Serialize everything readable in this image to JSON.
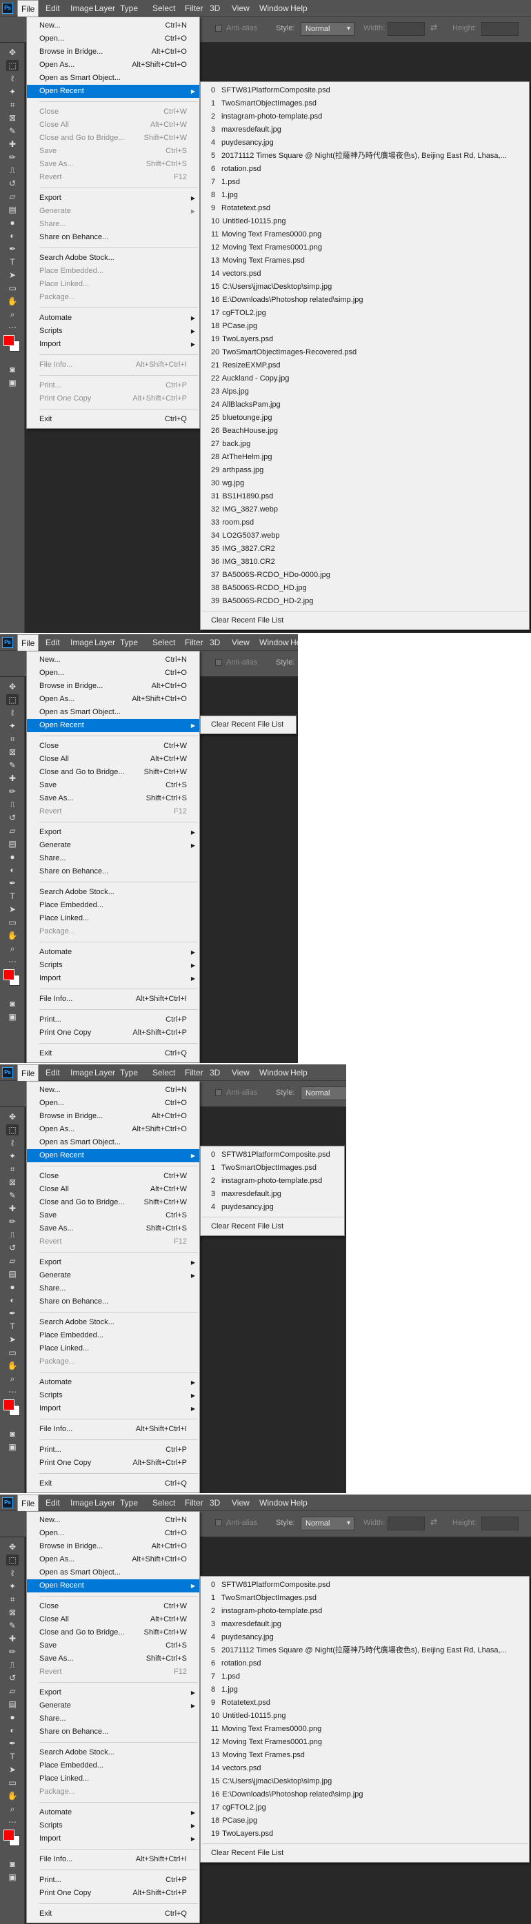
{
  "app": {
    "logo": "Ps"
  },
  "menubar": [
    "File",
    "Edit",
    "Image",
    "Layer",
    "Type",
    "Select",
    "Filter",
    "3D",
    "View",
    "Window",
    "Help"
  ],
  "options": {
    "anti_alias": "Anti-alias",
    "style_label": "Style:",
    "style_value": "Normal",
    "width_label": "Width:",
    "height_label": "Height:"
  },
  "tools": [
    "move-icon",
    "marquee-icon",
    "lasso-icon",
    "magic-wand-icon",
    "crop-icon",
    "frame-icon",
    "eyedropper-icon",
    "healing-brush-icon",
    "brush-icon",
    "clone-stamp-icon",
    "history-brush-icon",
    "eraser-icon",
    "gradient-icon",
    "blur-icon",
    "dodge-icon",
    "pen-icon",
    "text-icon",
    "path-selection-icon",
    "rectangle-icon",
    "hand-icon",
    "zoom-icon",
    "more-tools-icon",
    "swap-colors-icon",
    "quick-mask-icon",
    "screen-mode-icon"
  ],
  "colors": {
    "foreground": "#ff0000",
    "background": "#ffffff",
    "highlight": "#0078d7"
  },
  "file_menu": [
    {
      "label": "New...",
      "shortcut": "Ctrl+N"
    },
    {
      "label": "Open...",
      "shortcut": "Ctrl+O"
    },
    {
      "label": "Browse in Bridge...",
      "shortcut": "Alt+Ctrl+O"
    },
    {
      "label": "Open As...",
      "shortcut": "Alt+Shift+Ctrl+O"
    },
    {
      "label": "Open as Smart Object..."
    },
    {
      "label": "Open Recent",
      "submenu": true,
      "highlight": true
    },
    {
      "sep": true
    },
    {
      "label": "Close",
      "shortcut": "Ctrl+W"
    },
    {
      "label": "Close All",
      "shortcut": "Alt+Ctrl+W"
    },
    {
      "label": "Close and Go to Bridge...",
      "shortcut": "Shift+Ctrl+W"
    },
    {
      "label": "Save",
      "shortcut": "Ctrl+S"
    },
    {
      "label": "Save As...",
      "shortcut": "Shift+Ctrl+S"
    },
    {
      "label": "Revert",
      "shortcut": "F12",
      "disabled": true
    },
    {
      "sep": true
    },
    {
      "label": "Export",
      "submenu": true
    },
    {
      "label": "Generate",
      "submenu": true
    },
    {
      "label": "Share..."
    },
    {
      "label": "Share on Behance..."
    },
    {
      "sep": true
    },
    {
      "label": "Search Adobe Stock..."
    },
    {
      "label": "Place Embedded..."
    },
    {
      "label": "Place Linked..."
    },
    {
      "label": "Package...",
      "disabled": true
    },
    {
      "sep": true
    },
    {
      "label": "Automate",
      "submenu": true
    },
    {
      "label": "Scripts",
      "submenu": true
    },
    {
      "label": "Import",
      "submenu": true
    },
    {
      "sep": true
    },
    {
      "label": "File Info...",
      "shortcut": "Alt+Shift+Ctrl+I"
    },
    {
      "sep": true
    },
    {
      "label": "Print...",
      "shortcut": "Ctrl+P"
    },
    {
      "label": "Print One Copy",
      "shortcut": "Alt+Shift+Ctrl+P"
    },
    {
      "sep": true
    },
    {
      "label": "Exit",
      "shortcut": "Ctrl+Q"
    }
  ],
  "recent_files": [
    "0 SFTW81PlatformComposite.psd",
    "1 TwoSmartObjectImages.psd",
    "2 instagram-photo-template.psd",
    "3 maxresdefault.jpg",
    "4 puydesancy.jpg",
    "5 20171112 Times Square @ Night(拉薩神乃時代廣場夜色s), Beijing East Rd, Lhasa,...",
    "6 rotation.psd",
    "7 1.psd",
    "8 1.jpg",
    "9 Rotatetext.psd",
    "10 Untitled-10115.png",
    "11 Moving Text Frames0000.png",
    "12 Moving Text Frames0001.png",
    "13 Moving Text Frames.psd",
    "14 vectors.psd",
    "15 C:\\Users\\jjmac\\Desktop\\simp.jpg",
    "16 E:\\Downloads\\Photoshop related\\simp.jpg",
    "17 cgFTOL2.jpg",
    "18 PCase.jpg",
    "19 TwoLayers.psd",
    "20 TwoSmartObjectImages-Recovered.psd",
    "21 ResizeEXMP.psd",
    "22 Auckland - Copy.jpg",
    "23 Alps.jpg",
    "24 AllBlacksPam.jpg",
    "25 bluetounge.jpg",
    "26 BeachHouse.jpg",
    "27 back.jpg",
    "28 AtTheHelm.jpg",
    "29 arthpass.jpg",
    "30 wg.jpg",
    "31 BS1H1890.psd",
    "32 IMG_3827.webp",
    "33 room.psd",
    "34 LO2G5037.webp",
    "35 IMG_3827.CR2",
    "36 IMG_3810.CR2",
    "37 BA5006S-RCDO_HDo-0000.jpg",
    "38 BA5006S-RCDO_HD.jpg",
    "39 BA5006S-RCDO_HD-2.jpg"
  ],
  "clear_recent": "Clear Recent File List",
  "panels": [
    {
      "variant": "full",
      "recent_count": 40,
      "first_five_disabled": true
    },
    {
      "variant": "empty",
      "recent_count": 0,
      "first_five_disabled": false
    },
    {
      "variant": "five",
      "recent_count": 5,
      "first_five_disabled": false
    },
    {
      "variant": "twenty",
      "recent_count": 20,
      "first_five_disabled": false
    }
  ]
}
